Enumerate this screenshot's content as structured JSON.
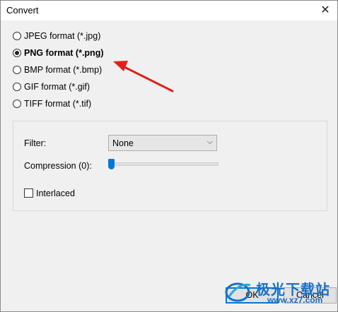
{
  "window": {
    "title": "Convert",
    "close_icon": "✕"
  },
  "formats": [
    {
      "label": "JPEG format (*.jpg)",
      "selected": false
    },
    {
      "label": "PNG format (*.png)",
      "selected": true
    },
    {
      "label": "BMP format (*.bmp)",
      "selected": false
    },
    {
      "label": "GIF format (*.gif)",
      "selected": false
    },
    {
      "label": "TIFF format (*.tif)",
      "selected": false
    }
  ],
  "options": {
    "filter_label": "Filter:",
    "filter_value": "None",
    "compression_label": "Compression (0):",
    "compression_value": 0,
    "interlaced_label": "Interlaced",
    "interlaced_checked": false
  },
  "buttons": {
    "ok": "OK",
    "cancel": "Cancel"
  },
  "annotation": {
    "arrow_color": "#e02020"
  },
  "watermark": {
    "text": "极光下载站",
    "url": "www.xz7.com"
  }
}
